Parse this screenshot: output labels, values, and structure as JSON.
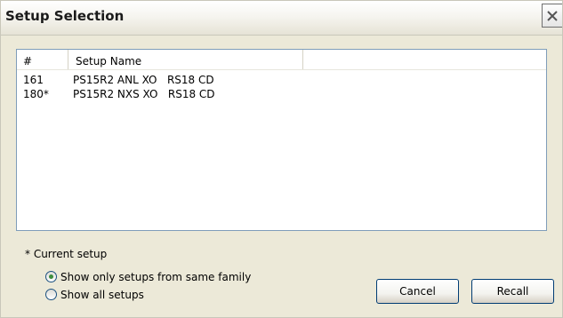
{
  "window": {
    "title": "Setup Selection",
    "close_icon": "close-icon"
  },
  "list": {
    "columns": [
      "#",
      "Setup Name"
    ],
    "rows": [
      {
        "num": "161",
        "name": "PS15R2 ANL XO   RS18 CD"
      },
      {
        "num": "180*",
        "name": "PS15R2 NXS XO   RS18 CD"
      }
    ]
  },
  "footnote": "* Current setup",
  "filter": {
    "options": [
      {
        "label": "Show only setups from same family",
        "selected": true
      },
      {
        "label": "Show all setups",
        "selected": false
      }
    ]
  },
  "buttons": {
    "cancel": "Cancel",
    "recall": "Recall"
  },
  "colors": {
    "dialog_bg": "#ece9d8",
    "list_border": "#7f9db9",
    "radio_dot": "#3d8c3d"
  }
}
